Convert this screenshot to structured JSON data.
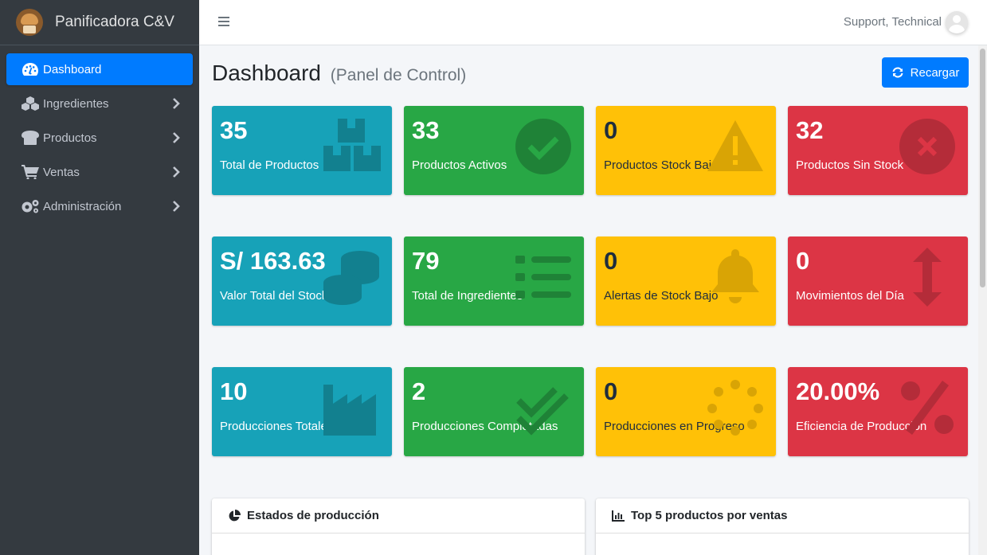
{
  "brand": {
    "name": "Panificadora C&V"
  },
  "sidebar": {
    "items": [
      {
        "label": "Dashboard",
        "icon": "tachometer-icon",
        "active": true
      },
      {
        "label": "Ingredientes",
        "icon": "cubes-icon",
        "has_children": true
      },
      {
        "label": "Productos",
        "icon": "bread-icon",
        "has_children": true
      },
      {
        "label": "Ventas",
        "icon": "cart-icon",
        "has_children": true
      },
      {
        "label": "Administración",
        "icon": "cogs-icon",
        "has_children": true
      }
    ]
  },
  "topbar": {
    "user_name": "Support, Technical"
  },
  "header": {
    "title": "Dashboard",
    "subtitle": "(Panel de Control)",
    "reload_label": "Recargar"
  },
  "cards": [
    {
      "value": "35",
      "label": "Total de Productos",
      "color": "info",
      "icon": "boxes-icon"
    },
    {
      "value": "33",
      "label": "Productos Activos",
      "color": "success",
      "icon": "check-circle-icon"
    },
    {
      "value": "0",
      "label": "Productos Stock Bajo",
      "color": "warning",
      "icon": "warning-triangle-icon"
    },
    {
      "value": "32",
      "label": "Productos Sin Stock",
      "color": "danger",
      "icon": "times-circle-icon"
    },
    {
      "value": "S/ 163.63",
      "label": "Valor Total del Stock",
      "color": "info",
      "icon": "coins-icon"
    },
    {
      "value": "79",
      "label": "Total de Ingredientes",
      "color": "success",
      "icon": "list-icon"
    },
    {
      "value": "0",
      "label": "Alertas de Stock Bajo",
      "color": "warning",
      "icon": "bell-icon"
    },
    {
      "value": "0",
      "label": "Movimientos del Día",
      "color": "danger",
      "icon": "arrows-vertical-icon"
    },
    {
      "value": "10",
      "label": "Producciones Totales",
      "color": "info",
      "icon": "industry-icon"
    },
    {
      "value": "2",
      "label": "Producciones Completadas",
      "color": "success",
      "icon": "double-check-icon"
    },
    {
      "value": "0",
      "label": "Producciones en Progreso",
      "color": "warning",
      "icon": "spinner-icon"
    },
    {
      "value": "20.00%",
      "label": "Eficiencia de Producción",
      "color": "danger",
      "icon": "percent-icon"
    }
  ],
  "panels": [
    {
      "title": "Estados de producción",
      "icon": "pie-chart-icon"
    },
    {
      "title": "Top 5 productos por ventas",
      "icon": "bar-chart-icon"
    }
  ],
  "colors": {
    "primary": "#007bff",
    "info": "#17a2b8",
    "success": "#28a745",
    "warning": "#ffc107",
    "danger": "#dc3545",
    "sidebar": "#343a40"
  }
}
